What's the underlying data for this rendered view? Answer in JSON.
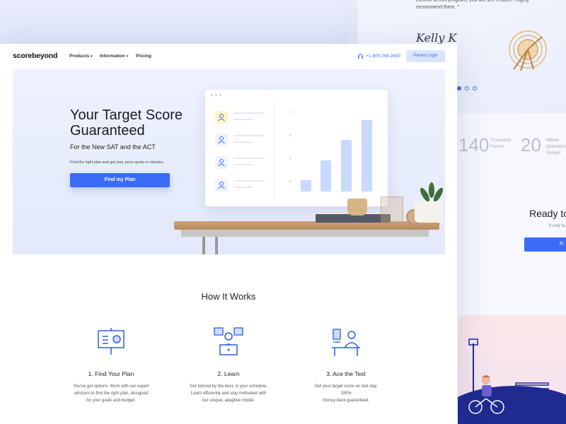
{
  "background_page": {
    "quote_lines": "commit to this program, you will see results. I highly\nrecommend them. \"",
    "signature": "Kelly K",
    "stats": [
      {
        "value": "140",
        "label": "Thousand\nParent"
      },
      {
        "value": "20",
        "label": "Million\nQuestions\nSolved"
      }
    ],
    "cta_title": "Ready to",
    "cta_sub": "It only ta",
    "cta_button": "Fi"
  },
  "nav": {
    "logo": "scorebeyond",
    "items": [
      {
        "label": "Products",
        "caret": "▾"
      },
      {
        "label": "Information",
        "caret": "▾"
      },
      {
        "label": "Pricing",
        "caret": ""
      }
    ],
    "phone": "+1 800 294 2630",
    "login": "Parent Login"
  },
  "hero": {
    "title": "Your Target Score Guaranteed",
    "subtitle": "For the New SAT and the ACT",
    "note": "Find the right plan and get your price quote in minutes.",
    "button": "Find my Plan",
    "chart_bars": [
      0.12,
      0.34,
      0.56,
      0.78
    ]
  },
  "how": {
    "title": "How It Works",
    "steps": [
      {
        "icon": "presentation-board-icon",
        "title": "1. Find Your Plan",
        "desc": "You've got options. Work with our expert\nadvisors to find the right plan, designed\nfor your goals and budget."
      },
      {
        "icon": "laptop-tutor-icon",
        "title": "2. Learn",
        "desc": "Get tutored by the best, in your schedule.\nLearn efficiently and stay motivated with\nour unique, adaptive model."
      },
      {
        "icon": "student-desk-icon",
        "title": "3. Ace the Test",
        "desc": "Get your target score on test day,\n100%\nmoney-back guaranteed."
      }
    ]
  },
  "colors": {
    "accent": "#3b6cf6",
    "hero_bg": "#e8edfb"
  }
}
